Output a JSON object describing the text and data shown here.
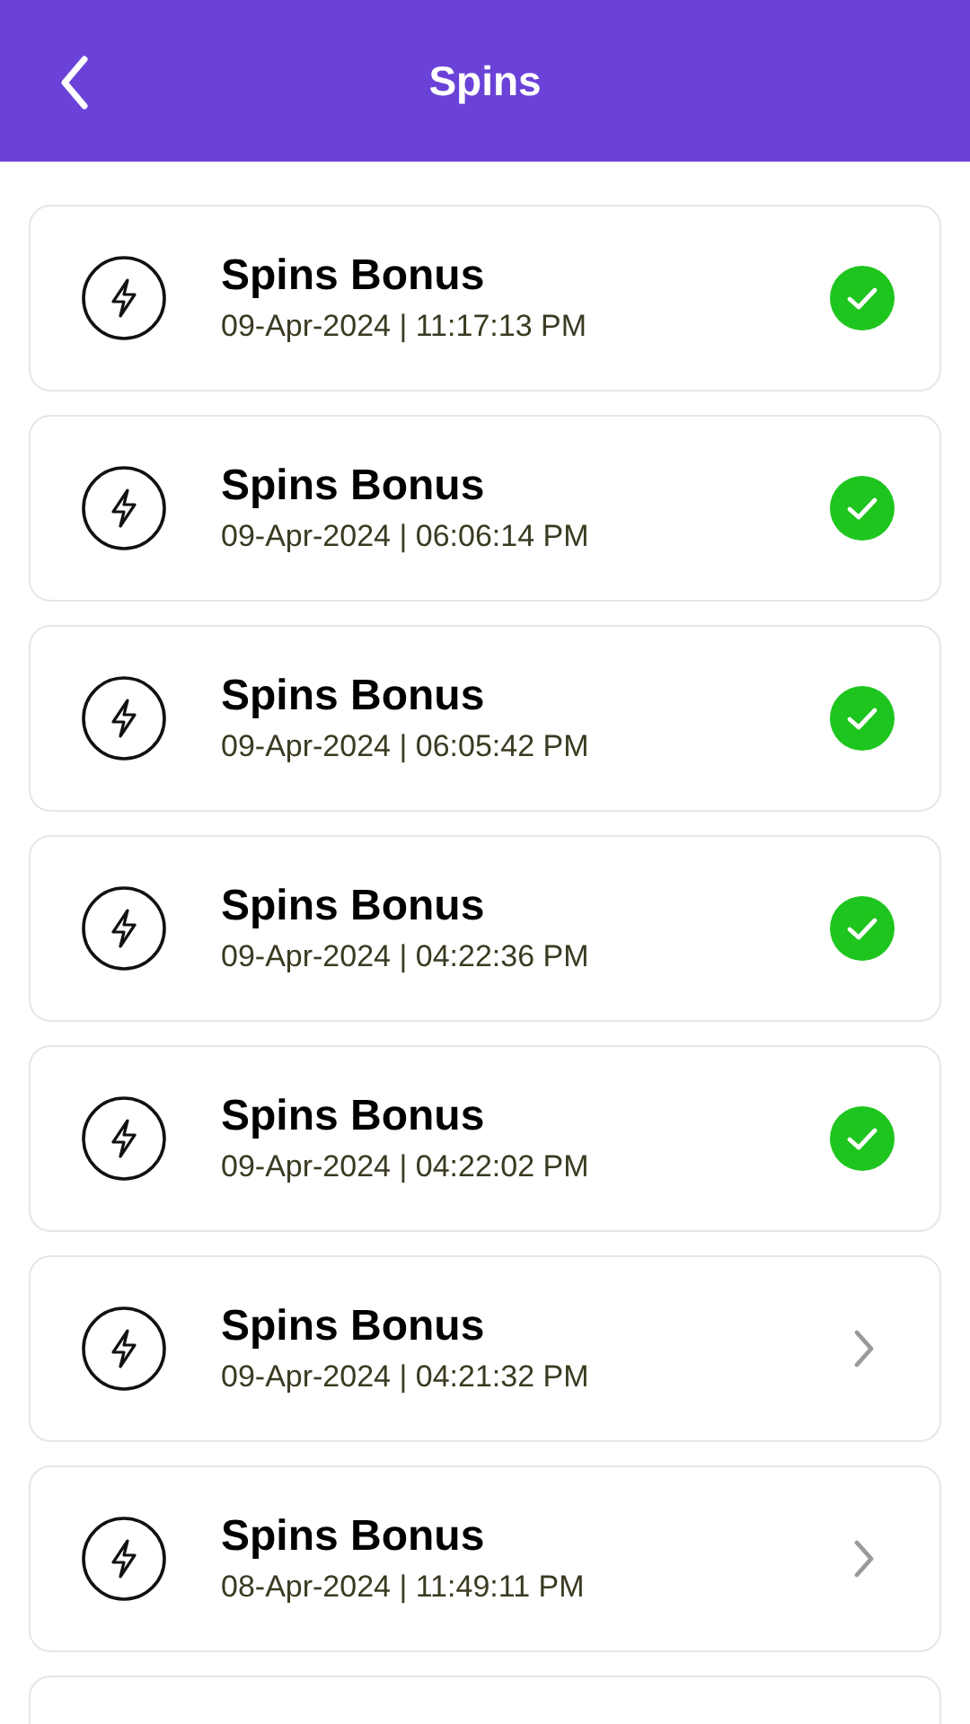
{
  "header": {
    "title": "Spins"
  },
  "items": [
    {
      "title": "Spins Bonus",
      "timestamp": "09-Apr-2024 | 11:17:13 PM",
      "completed": true
    },
    {
      "title": "Spins Bonus",
      "timestamp": "09-Apr-2024 | 06:06:14 PM",
      "completed": true
    },
    {
      "title": "Spins Bonus",
      "timestamp": "09-Apr-2024 | 06:05:42 PM",
      "completed": true
    },
    {
      "title": "Spins Bonus",
      "timestamp": "09-Apr-2024 | 04:22:36 PM",
      "completed": true
    },
    {
      "title": "Spins Bonus",
      "timestamp": "09-Apr-2024 | 04:22:02 PM",
      "completed": true
    },
    {
      "title": "Spins Bonus",
      "timestamp": "09-Apr-2024 | 04:21:32 PM",
      "completed": false
    },
    {
      "title": "Spins Bonus",
      "timestamp": "08-Apr-2024 | 11:49:11 PM",
      "completed": false
    }
  ]
}
